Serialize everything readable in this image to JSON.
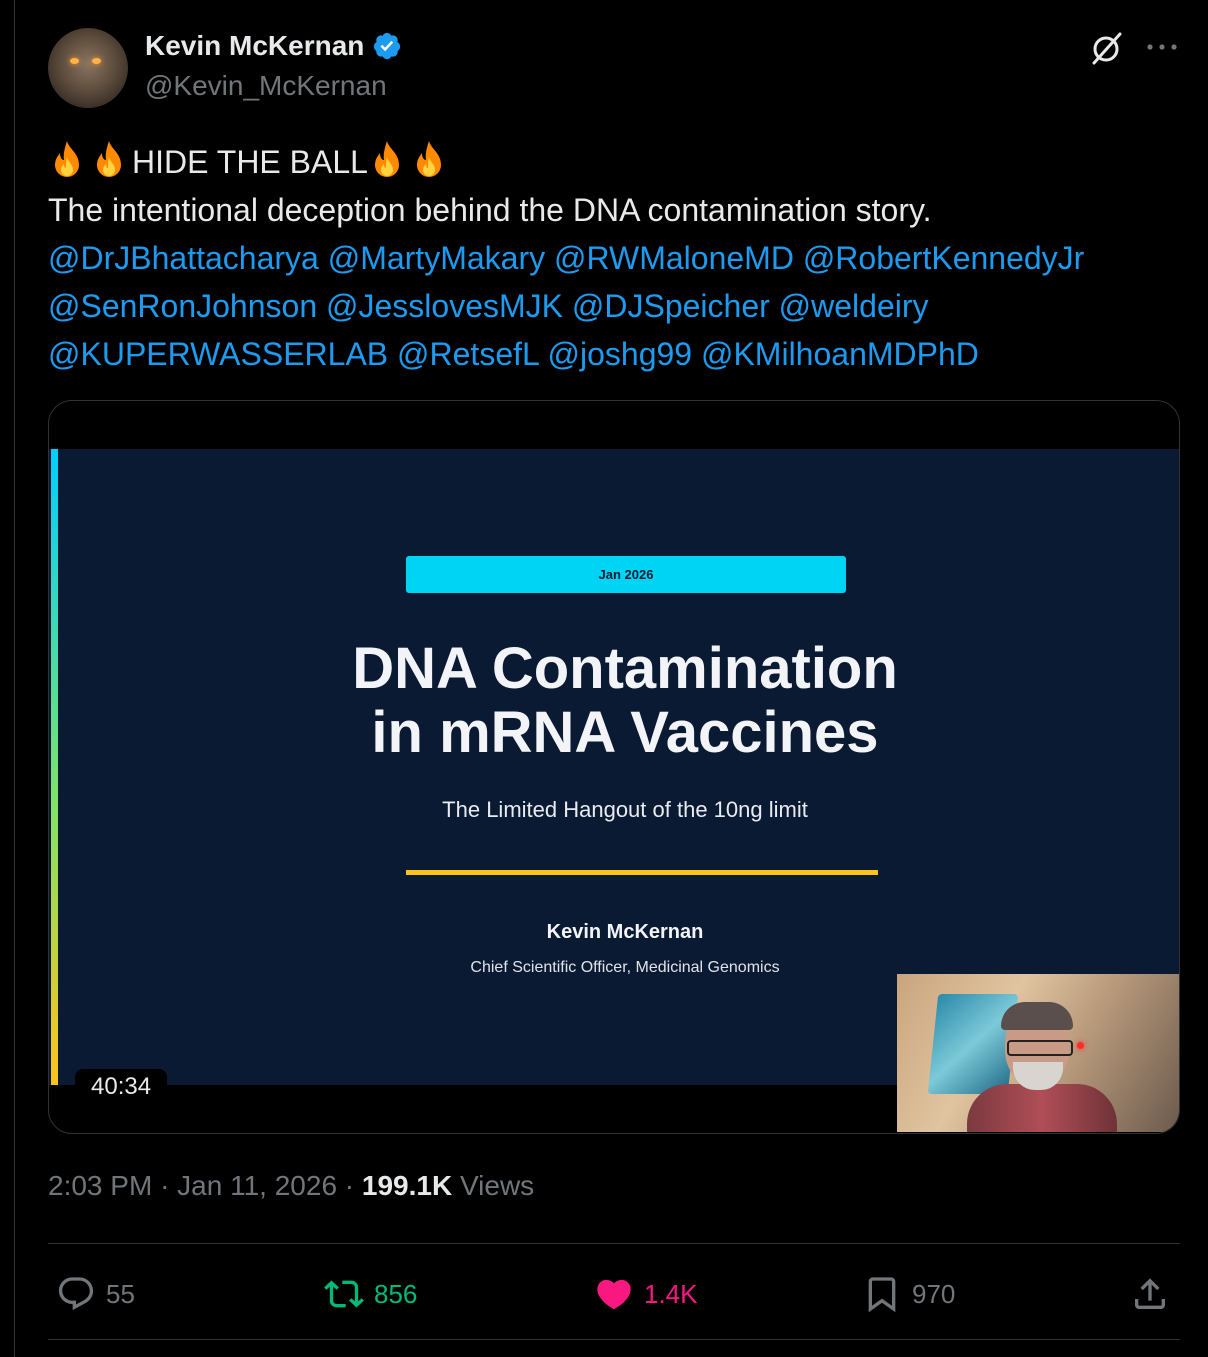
{
  "author": {
    "name": "Kevin McKernan",
    "handle": "@Kevin_McKernan"
  },
  "tweet": {
    "headline": "HIDE THE BALL",
    "body_line": "The intentional deception behind the DNA contamination story.",
    "mentions": [
      "@DrJBhattacharya",
      "@MartyMakary",
      "@RWMaloneMD",
      "@RobertKennedyJr",
      "@SenRonJohnson",
      "@JesslovesMJK",
      "@DJSpeicher",
      "@weldeiry",
      "@KUPERWASSERLAB",
      "@RetsefL",
      "@joshg99",
      "@KMilhoanMDPhD"
    ]
  },
  "media": {
    "slide_date": "Jan 2026",
    "slide_title_line1": "DNA Contamination",
    "slide_title_line2": "in mRNA Vaccines",
    "slide_subtitle": "The Limited Hangout of the 10ng limit",
    "presenter_name": "Kevin McKernan",
    "presenter_role": "Chief Scientific Officer, Medicinal Genomics",
    "duration": "40:34"
  },
  "meta": {
    "time": "2:03 PM",
    "date": "Jan 11, 2026",
    "dot": "·",
    "views_count": "199.1K",
    "views_label": "Views"
  },
  "actions": {
    "replies": "55",
    "reposts": "856",
    "likes": "1.4K",
    "bookmarks": "970"
  },
  "colors": {
    "background": "#000000",
    "text": "#e7e9ea",
    "secondary": "#71767b",
    "link": "#1d9bf0",
    "repost_active": "#00ba7c",
    "like_active": "#f91880",
    "slide_bg": "#0b1a33",
    "slide_accent_cyan": "#00d4f5",
    "slide_accent_gold": "#ffc21a"
  }
}
